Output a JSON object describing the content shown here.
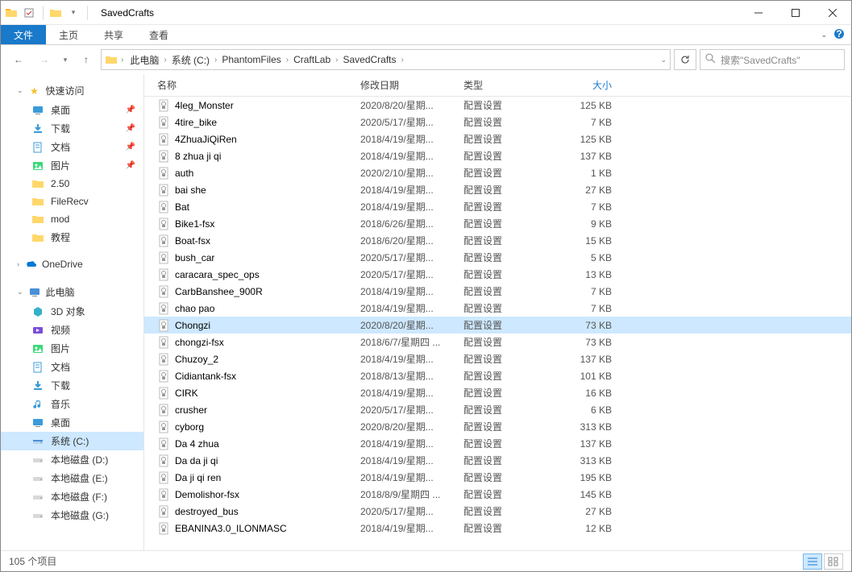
{
  "window": {
    "title": "SavedCrafts"
  },
  "ribbon": {
    "file": "文件",
    "tabs": [
      "主页",
      "共享",
      "查看"
    ]
  },
  "breadcrumb": {
    "segments": [
      "此电脑",
      "系统 (C:)",
      "PhantomFiles",
      "CraftLab",
      "SavedCrafts"
    ]
  },
  "search": {
    "placeholder": "搜索\"SavedCrafts\""
  },
  "columns": {
    "name": "名称",
    "date": "修改日期",
    "type": "类型",
    "size": "大小"
  },
  "nav": {
    "quick": {
      "label": "快速访问",
      "items": [
        {
          "label": "桌面",
          "ico": "desktop",
          "pinned": true
        },
        {
          "label": "下载",
          "ico": "downloads",
          "pinned": true
        },
        {
          "label": "文档",
          "ico": "docs",
          "pinned": true
        },
        {
          "label": "图片",
          "ico": "pictures",
          "pinned": true
        },
        {
          "label": "2.50",
          "ico": "folder",
          "pinned": false
        },
        {
          "label": "FileRecv",
          "ico": "folder",
          "pinned": false
        },
        {
          "label": "mod",
          "ico": "folder",
          "pinned": false
        },
        {
          "label": "教程",
          "ico": "folder",
          "pinned": false
        }
      ]
    },
    "onedrive": {
      "label": "OneDrive"
    },
    "pc": {
      "label": "此电脑",
      "items": [
        {
          "label": "3D 对象",
          "ico": "3d"
        },
        {
          "label": "视频",
          "ico": "video"
        },
        {
          "label": "图片",
          "ico": "pictures"
        },
        {
          "label": "文档",
          "ico": "docs"
        },
        {
          "label": "下载",
          "ico": "downloads"
        },
        {
          "label": "音乐",
          "ico": "music"
        },
        {
          "label": "桌面",
          "ico": "desktop"
        },
        {
          "label": "系统 (C:)",
          "ico": "drive",
          "selected": true
        },
        {
          "label": "本地磁盘 (D:)",
          "ico": "drive2"
        },
        {
          "label": "本地磁盘 (E:)",
          "ico": "drive2"
        },
        {
          "label": "本地磁盘 (F:)",
          "ico": "drive2"
        },
        {
          "label": "本地磁盘 (G:)",
          "ico": "drive2"
        }
      ]
    }
  },
  "files": [
    {
      "name": "4leg_Monster",
      "date": "2020/8/20/星期...",
      "type": "配置设置",
      "size": "125 KB"
    },
    {
      "name": "4tire_bike",
      "date": "2020/5/17/星期...",
      "type": "配置设置",
      "size": "7 KB"
    },
    {
      "name": "4ZhuaJiQiRen",
      "date": "2018/4/19/星期...",
      "type": "配置设置",
      "size": "125 KB"
    },
    {
      "name": "8 zhua ji qi",
      "date": "2018/4/19/星期...",
      "type": "配置设置",
      "size": "137 KB"
    },
    {
      "name": "auth",
      "date": "2020/2/10/星期...",
      "type": "配置设置",
      "size": "1 KB"
    },
    {
      "name": "bai she",
      "date": "2018/4/19/星期...",
      "type": "配置设置",
      "size": "27 KB"
    },
    {
      "name": "Bat",
      "date": "2018/4/19/星期...",
      "type": "配置设置",
      "size": "7 KB"
    },
    {
      "name": "Bike1-fsx",
      "date": "2018/6/26/星期...",
      "type": "配置设置",
      "size": "9 KB"
    },
    {
      "name": "Boat-fsx",
      "date": "2018/6/20/星期...",
      "type": "配置设置",
      "size": "15 KB"
    },
    {
      "name": "bush_car",
      "date": "2020/5/17/星期...",
      "type": "配置设置",
      "size": "5 KB"
    },
    {
      "name": "caracara_spec_ops",
      "date": "2020/5/17/星期...",
      "type": "配置设置",
      "size": "13 KB"
    },
    {
      "name": "CarbBanshee_900R",
      "date": "2018/4/19/星期...",
      "type": "配置设置",
      "size": "7 KB"
    },
    {
      "name": "chao pao",
      "date": "2018/4/19/星期...",
      "type": "配置设置",
      "size": "7 KB"
    },
    {
      "name": "Chongzi",
      "date": "2020/8/20/星期...",
      "type": "配置设置",
      "size": "73 KB",
      "selected": true
    },
    {
      "name": "chongzi-fsx",
      "date": "2018/6/7/星期四 ...",
      "type": "配置设置",
      "size": "73 KB"
    },
    {
      "name": "Chuzoy_2",
      "date": "2018/4/19/星期...",
      "type": "配置设置",
      "size": "137 KB"
    },
    {
      "name": "Cidiantank-fsx",
      "date": "2018/8/13/星期...",
      "type": "配置设置",
      "size": "101 KB"
    },
    {
      "name": "CIRK",
      "date": "2018/4/19/星期...",
      "type": "配置设置",
      "size": "16 KB"
    },
    {
      "name": "crusher",
      "date": "2020/5/17/星期...",
      "type": "配置设置",
      "size": "6 KB"
    },
    {
      "name": "cyborg",
      "date": "2020/8/20/星期...",
      "type": "配置设置",
      "size": "313 KB"
    },
    {
      "name": "Da 4 zhua",
      "date": "2018/4/19/星期...",
      "type": "配置设置",
      "size": "137 KB"
    },
    {
      "name": "Da da ji qi",
      "date": "2018/4/19/星期...",
      "type": "配置设置",
      "size": "313 KB"
    },
    {
      "name": "Da ji qi ren",
      "date": "2018/4/19/星期...",
      "type": "配置设置",
      "size": "195 KB"
    },
    {
      "name": "Demolishor-fsx",
      "date": "2018/8/9/星期四 ...",
      "type": "配置设置",
      "size": "145 KB"
    },
    {
      "name": "destroyed_bus",
      "date": "2020/5/17/星期...",
      "type": "配置设置",
      "size": "27 KB"
    },
    {
      "name": "EBANINA3.0_ILONMASC",
      "date": "2018/4/19/星期...",
      "type": "配置设置",
      "size": "12 KB"
    }
  ],
  "status": {
    "count": "105 个项目"
  }
}
